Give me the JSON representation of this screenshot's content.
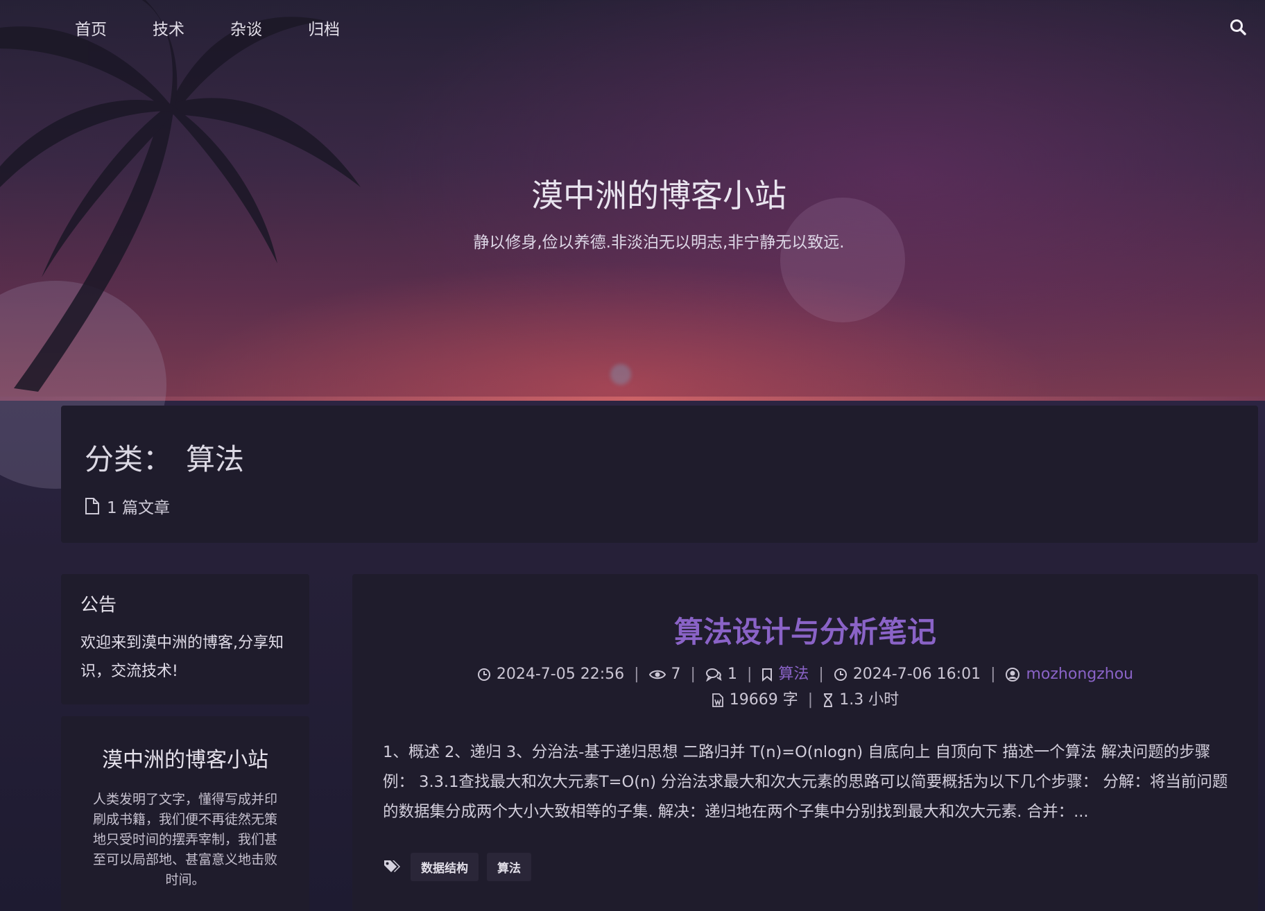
{
  "nav": {
    "items": [
      "首页",
      "技术",
      "杂谈",
      "归档"
    ],
    "search_icon": "search-icon"
  },
  "hero": {
    "title": "漠中洲的博客小站",
    "subtitle": "静以修身,俭以养德.非淡泊无以明志,非宁静无以致远."
  },
  "category": {
    "label": "分类：",
    "name": "算法",
    "count_text": "1 篇文章"
  },
  "sidebar": {
    "notice": {
      "title": "公告",
      "text": "欢迎来到漠中洲的博客,分享知识，交流技术!"
    },
    "profile": {
      "title": "漠中洲的博客小站",
      "text": "人类发明了文字，懂得写成并印刷成书籍，我们便不再徒然无策地只受时间的摆弄宰制，我们甚至可以局部地、甚富意义地击败时间。"
    }
  },
  "post": {
    "title": "算法设计与分析笔记",
    "meta": {
      "created": "2024-7-05 22:56",
      "views": "7",
      "comments": "1",
      "category": "算法",
      "updated": "2024-7-06 16:01",
      "author": "mozhongzhou",
      "words": "19669 字",
      "reading_time": "1.3 小时"
    },
    "excerpt": "1、概述 2、递归 3、分治法-基于递归思想 二路归并 T(n)=O(nlogn) 自底向上 自顶向下 描述一个算法 解决问题的步骤 例： 3.3.1查找最大和次大元素T=O(n) 分治法求最大和次大元素的思路可以简要概括为以下几个步骤： 分解：将当前问题的数据集分成两个大小大致相等的子集. 解决：递归地在两个子集中分别找到最大和次大元素. 合并：...",
    "tags": [
      "数据结构",
      "算法"
    ]
  },
  "colors": {
    "accent": "#8a63c7",
    "card_bg": "#1f1c2c"
  }
}
